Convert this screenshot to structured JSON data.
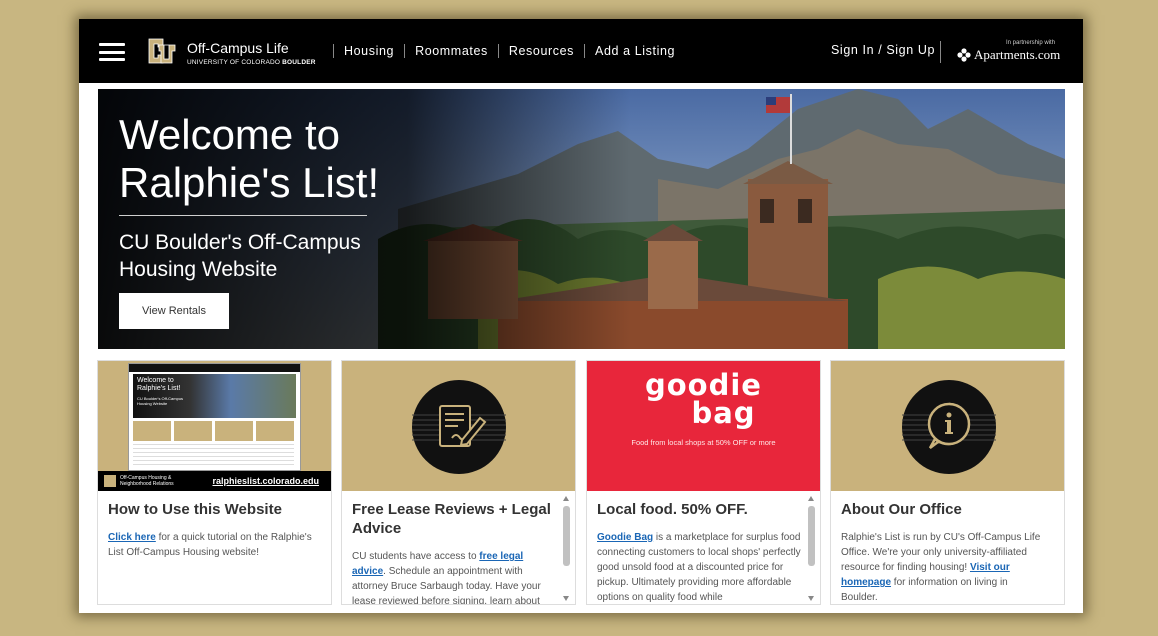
{
  "nav": {
    "logo_title": "Off-Campus Life",
    "logo_subtitle_a": "UNIVERSITY OF COLORADO ",
    "logo_subtitle_b": "BOULDER",
    "links": [
      "Housing",
      "Roommates",
      "Resources",
      "Add a Listing"
    ],
    "sign_in": "Sign In / Sign Up",
    "partner_note": "In partnership with",
    "partner_name": "Apartments.com"
  },
  "hero": {
    "title": "Welcome to Ralphie's List!",
    "subtitle": "CU Boulder's Off-Campus Housing Website",
    "button": "View Rentals"
  },
  "cards": [
    {
      "title": "How to Use this Website",
      "body_link": "Click here",
      "body_text": " for a quick tutorial on the Ralphie's List Off-Campus Housing website!",
      "thumb_footer_url": "ralphieslist.colorado.edu",
      "thumb_footer_org": "Off-Campus Housing & Neighborhood Relations",
      "thumb_title": "Welcome to Ralphie's List!",
      "thumb_sub": "CU Boulder's Off-Campus Housing Website"
    },
    {
      "title": "Free Lease Reviews + Legal Advice",
      "body_a": "CU students have access to ",
      "body_link": "free legal advice",
      "body_b": ". Schedule an appointment with attorney Bruce Sarbaugh today. Have your lease reviewed before signing, learn about"
    },
    {
      "title": "Local food. 50% OFF.",
      "media_title_1": "goodie",
      "media_title_2": "bag",
      "media_tagline": "Food from local shops at 50% OFF or more",
      "body_link": "Goodie Bag",
      "body_text": " is a marketplace for surplus food connecting customers to local shops' perfectly good unsold food at a discounted price for pickup. Ultimately providing more affordable options on quality food while"
    },
    {
      "title": "About Our Office",
      "body_a": "Ralphie's List is run by CU's Off-Campus Life Office. We're your only university-affiliated resource for finding housing! ",
      "body_link": "Visit our homepage",
      "body_b": " for information on living in Boulder."
    }
  ],
  "colors": {
    "background": "#c8b681",
    "cu_gold": "#c9b27c",
    "nav": "#000000",
    "link": "#1a66b5",
    "goodie_red": "#e8263b"
  },
  "icons": [
    "menu-icon",
    "cu-logo-icon",
    "apartments-logo-icon",
    "document-pen-icon",
    "info-icon"
  ]
}
